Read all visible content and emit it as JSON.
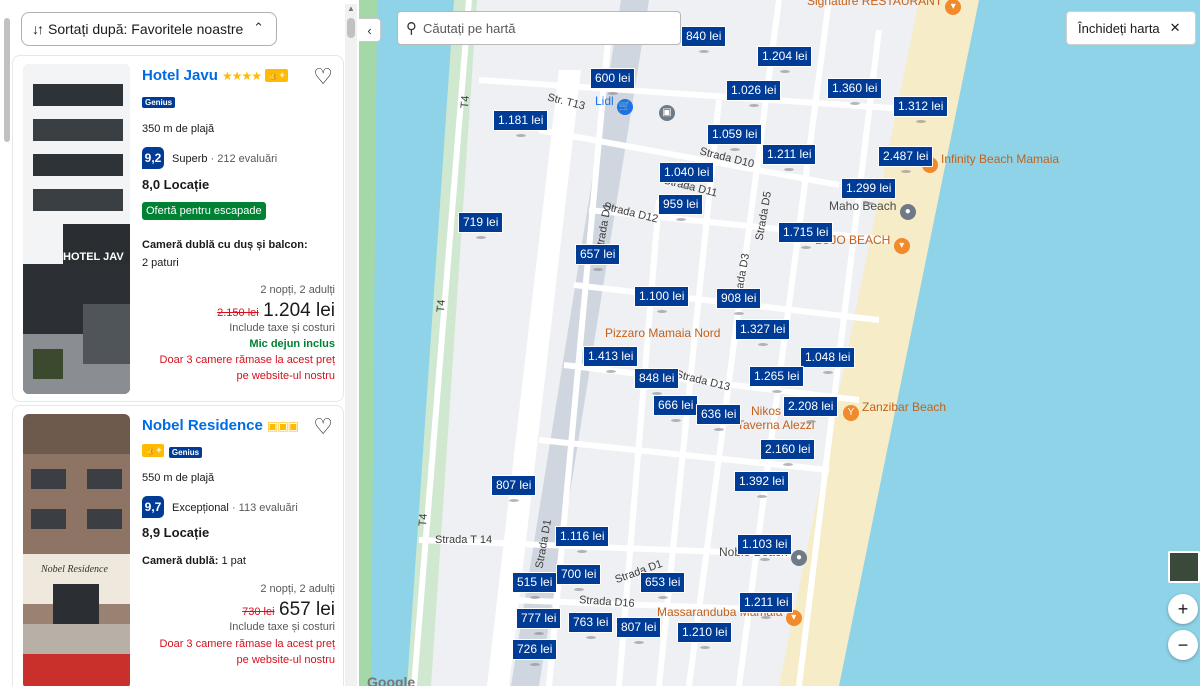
{
  "sort": {
    "icon": "sort-arrows-icon",
    "label": "Sortați după: Favoritele noastre"
  },
  "hotels": [
    {
      "name": "Hotel Javu",
      "stars": "★★★★",
      "badges": [
        "👍+",
        "Genius"
      ],
      "distance": "350 m de plajă",
      "score": "9,2",
      "score_word": "Superb",
      "reviews": "· 212 evaluări",
      "location": "8,0 Locație",
      "offer": "Ofertă pentru escapade",
      "room": "Cameră dublă cu duș și balcon:",
      "beds": "2 paturi",
      "nights": "2 nopți, 2 adulți",
      "old_price": "2.150 lei",
      "price": "1.204 lei",
      "taxes": "Include taxe și costuri",
      "perk": "Mic dejun inclus",
      "scarcity_1": "Doar 3 camere rămase la acest preț",
      "scarcity_2": "pe website-ul nostru",
      "photo_sign": "HOTEL JAV"
    },
    {
      "name": "Nobel Residence",
      "stars": "▣▣▣",
      "badges": [
        "👍+",
        "Genius"
      ],
      "distance": "550 m de plajă",
      "score": "9,7",
      "score_word": "Excepțional",
      "reviews": "· 113 evaluări",
      "location": "8,9 Locație",
      "room": "Cameră dublă:",
      "beds": "1 pat",
      "nights": "2 nopți, 2 adulți",
      "old_price": "730 lei",
      "price": "657 lei",
      "taxes": "Include taxe și costuri",
      "scarcity_1": "Doar 3 camere rămase la acest preț",
      "scarcity_2": "pe website-ul nostru",
      "photo_sign": "Nobel Residence"
    }
  ],
  "map": {
    "search_placeholder": "Căutați pe hartă",
    "close_label": "Închideți harta",
    "zoom_in": "+",
    "zoom_out": "−",
    "attribution": "Google",
    "pins": [
      "840 lei",
      "1.204 lei",
      "600 lei",
      "1.026 lei",
      "1.360 lei",
      "1.312 lei",
      "1.181 lei",
      "1.059 lei",
      "1.211 lei",
      "2.487 lei",
      "1.040 lei",
      "1.299 lei",
      "959 lei",
      "719 lei",
      "1.715 lei",
      "657 lei",
      "1.100 lei",
      "908 lei",
      "1.327 lei",
      "1.413 lei",
      "1.048 lei",
      "848 lei",
      "1.265 lei",
      "666 lei",
      "636 lei",
      "2.208 lei",
      "2.160 lei",
      "1.392 lei",
      "807 lei",
      "1.116 lei",
      "1.103 lei",
      "700 lei",
      "515 lei",
      "653 lei",
      "1.211 lei",
      "777 lei",
      "763 lei",
      "807 lei",
      "1.210 lei",
      "726 lei"
    ],
    "pois": {
      "signature": "Signature RESTAURANT",
      "lidl": "Lidl",
      "infinity": "Infinity Beach Mamaia",
      "maho": "Maho Beach",
      "lujo": "LUJO BEACH",
      "pizzaro": "Pizzaro Mamaia Nord",
      "zanzibar": "Zanzibar Beach",
      "nikos": "Nikos",
      "alezzi": "Taverna Alezzi",
      "noble": "Noble Beach",
      "massaranduba": "Massaranduba Mamaia"
    },
    "streets": {
      "t13": "Str. T13",
      "t4a": "T4",
      "t4b": "T4",
      "t4c": "T4",
      "d10": "Strada D10",
      "d11": "Strada D11",
      "d12": "Strada D12",
      "d1a": "Strada D1",
      "d1b": "Strada D1",
      "d5": "Strada D5",
      "d3": "Strada D3",
      "d13": "Strada D13",
      "t14": "Strada T 14",
      "d16": "Strada D16",
      "d1c": "Strada D1"
    }
  }
}
